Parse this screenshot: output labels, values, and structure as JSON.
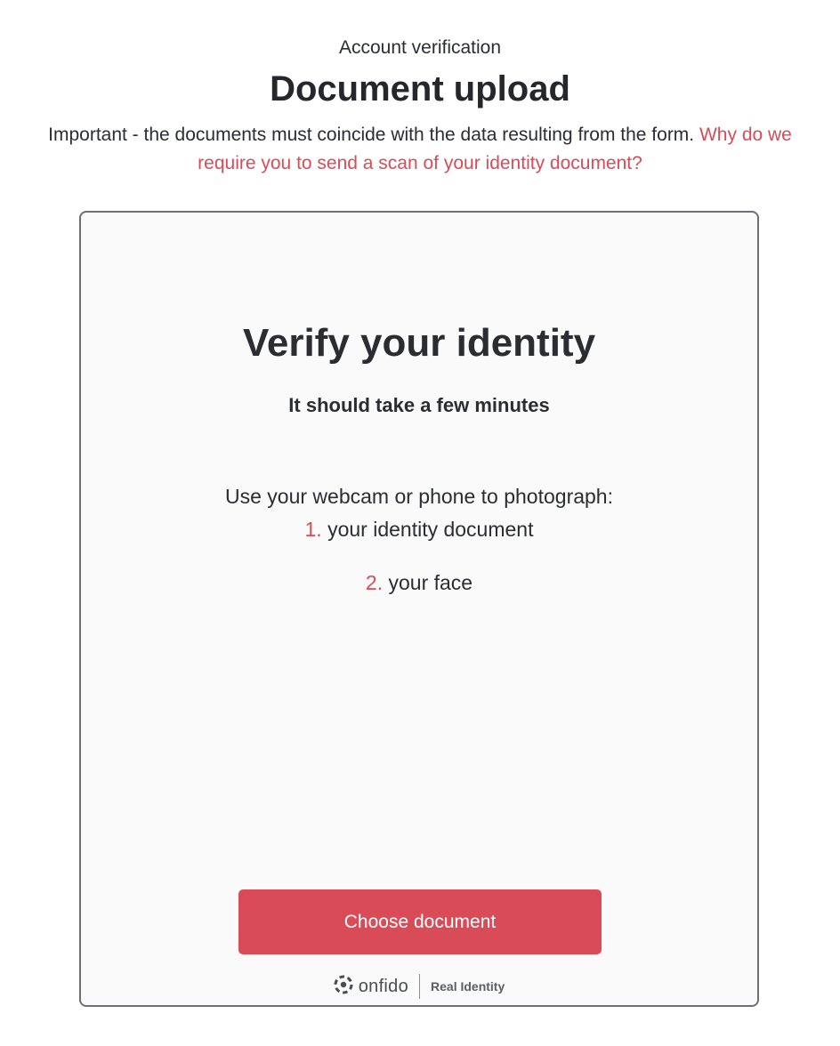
{
  "header": {
    "subtitle": "Account verification",
    "title": "Document upload",
    "intro_text": "Important - the documents must coincide with the data resulting from the form. ",
    "intro_link": "Why do we require you to send a scan of your identity document?"
  },
  "card": {
    "title": "Verify your identity",
    "subtitle": "It should take a few minutes",
    "instructions": "Use your webcam or phone to photograph:",
    "steps": [
      {
        "num": "1.",
        "label": "your identity document"
      },
      {
        "num": "2.",
        "label": "your face"
      }
    ],
    "button_label": "Choose document"
  },
  "footer": {
    "brand": "onfido",
    "tagline": "Real Identity",
    "icon": "onfido-logo-icon"
  },
  "colors": {
    "accent": "#d94b57",
    "text": "#2b2d33",
    "card_bg": "#fafafa",
    "card_border": "#6e6f75"
  }
}
